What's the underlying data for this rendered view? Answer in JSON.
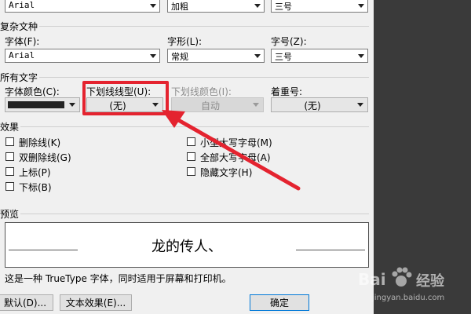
{
  "top_row": {
    "font": "Arial",
    "style": "加粗",
    "size": "三号"
  },
  "complex_script": {
    "title": "复杂文种",
    "font_label": "字体(F):",
    "font_value": "Arial",
    "style_label": "字形(L):",
    "style_value": "常规",
    "size_label": "字号(Z):",
    "size_value": "三号"
  },
  "all_text": {
    "title": "所有文字",
    "font_color_label": "字体颜色(C):",
    "underline_style_label": "下划线线型(U):",
    "underline_style_value": "(无)",
    "underline_color_label": "下划线颜色(I):",
    "underline_color_value": "自动",
    "emphasis_label": "着重号:",
    "emphasis_value": "(无)",
    "font_color_hex": "#222222"
  },
  "effects": {
    "title": "效果",
    "left": [
      "删除线(K)",
      "双删除线(G)",
      "上标(P)",
      "下标(B)"
    ],
    "right": [
      "小型大写字母(M)",
      "全部大写字母(A)",
      "隐藏文字(H)"
    ]
  },
  "preview": {
    "title": "预览",
    "sample": "龙的传人、",
    "note": "这是一种 TrueType 字体，同时适用于屏幕和打印机。"
  },
  "buttons": {
    "default": "默认(D)...",
    "text_effects": "文本效果(E)...",
    "ok": "确定"
  },
  "watermark": {
    "brand": "Bai",
    "brand_cn": "经验",
    "url": "jingyan.baidu.com"
  },
  "annotation_color": "#e4232f"
}
